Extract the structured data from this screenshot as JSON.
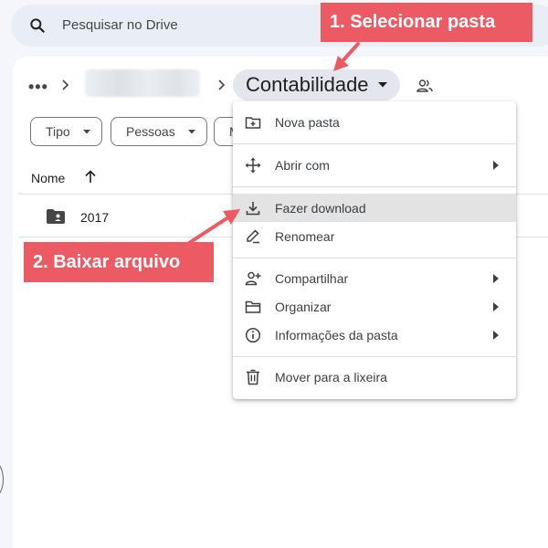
{
  "search": {
    "placeholder": "Pesquisar no Drive"
  },
  "breadcrumb": {
    "more": "•••",
    "current_folder": "Contabilidade"
  },
  "filters": [
    "Tipo",
    "Pessoas",
    "M"
  ],
  "list": {
    "header": {
      "name": "Nome",
      "sort": "up-arrow-icon"
    },
    "rows": [
      {
        "name": "2017",
        "icon": "shared-folder-icon"
      }
    ]
  },
  "context_menu": {
    "items": [
      {
        "label": "Nova pasta",
        "icon": "new-folder-icon"
      },
      {
        "label": "Abrir com",
        "icon": "open-with-icon",
        "submenu": true
      },
      {
        "label": "Fazer download",
        "icon": "download-icon",
        "highlighted": true
      },
      {
        "label": "Renomear",
        "icon": "rename-icon"
      },
      {
        "label": "Compartilhar",
        "icon": "share-person-icon",
        "submenu": true
      },
      {
        "label": "Organizar",
        "icon": "organize-folder-icon",
        "submenu": true
      },
      {
        "label": "Informações da pasta",
        "icon": "info-icon",
        "submenu": true
      },
      {
        "label": "Mover para a lixeira",
        "icon": "trash-icon"
      }
    ]
  },
  "annotations": {
    "step1": "1. Selecionar pasta",
    "step2": "2. Baixar arquivo",
    "color": "#ec5b63"
  }
}
